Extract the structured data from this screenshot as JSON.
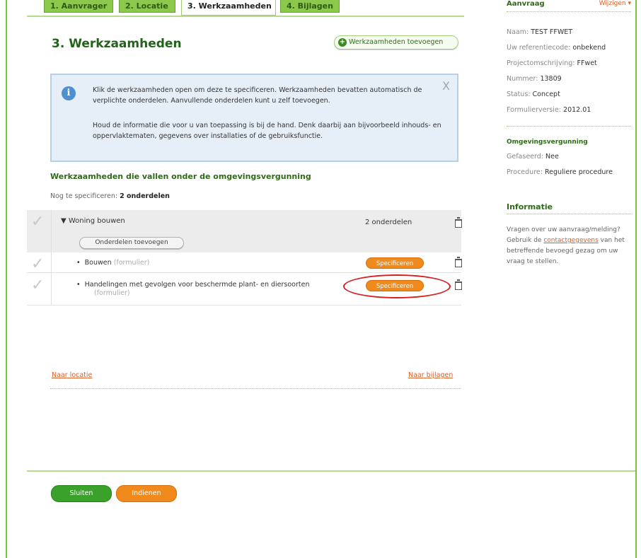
{
  "tabs": [
    {
      "label": "1. Aanvrager"
    },
    {
      "label": "2. Locatie"
    },
    {
      "label": "3. Werkzaamheden"
    },
    {
      "label": "4. Bijlagen"
    }
  ],
  "page": {
    "title": "3. Werkzaamheden",
    "add_button": "Werkzaamheden toevoegen"
  },
  "info": {
    "text1": "Klik de werkzaamheden open om deze te specificeren. Werkzaamheden bevatten automatisch de verplichte onderdelen. Aanvullende onderdelen kunt u zelf toevoegen.",
    "text2": "Houd de informatie die voor u van toepassing is bij de hand. Denk daarbij aan bijvoorbeeld inhouds- en oppervlaktematen, gegevens over installaties of de gebruiksfunctie.",
    "close": "X"
  },
  "section": {
    "heading": "Werkzaamheden die vallen onder de omgevingsvergunning",
    "nog_label": "Nog te specificeren:",
    "nog_value": "2 onderdelen"
  },
  "group": {
    "title": "Woning bouwen",
    "count": "2 onderdelen",
    "add_parts_button": "Onderdelen toevoegen"
  },
  "items": [
    {
      "label": "Bouwen",
      "tag": "(formulier)",
      "button": "Specificeren"
    },
    {
      "label": "Handelingen met gevolgen voor beschermde plant- en diersoorten",
      "tag": "(formulier)",
      "button": "Specificeren"
    }
  ],
  "nav": {
    "prev": "Naar locatie",
    "next": "Naar bijlagen"
  },
  "footer": {
    "close_button": "Sluiten",
    "submit_button": "Indienen"
  },
  "side": {
    "header": "Aanvraag",
    "header_right": "Wijzigen ▾",
    "fields": [
      {
        "k": "Naam:",
        "v": "TEST FFWET"
      },
      {
        "k": "Uw referentiecode:",
        "v": "onbekend"
      },
      {
        "k": "Projectomschrijving:",
        "v": "FFwet"
      },
      {
        "k": "Nummer:",
        "v": "13809"
      },
      {
        "k": "Status:",
        "v": "Concept"
      },
      {
        "k": "Formulierversie:",
        "v": "2012.01"
      }
    ],
    "omg_title": "Omgevingsvergunning",
    "omg_fields": [
      {
        "k": "Gefaseerd:",
        "v": "Nee"
      },
      {
        "k": "Procedure:",
        "v": "Reguliere procedure"
      }
    ],
    "info_title": "Informatie",
    "info_pre": "Vragen over uw aanvraag/melding? Gebruik de",
    "info_link": "contactgegevens",
    "info_post": "van het betreffende bevoegd gezag om uw vraag te stellen."
  },
  "colors": {
    "brand_green": "#7bc142",
    "title_green": "#23621a",
    "orange": "#f08a1c",
    "annotation_red": "#d81f1f"
  }
}
